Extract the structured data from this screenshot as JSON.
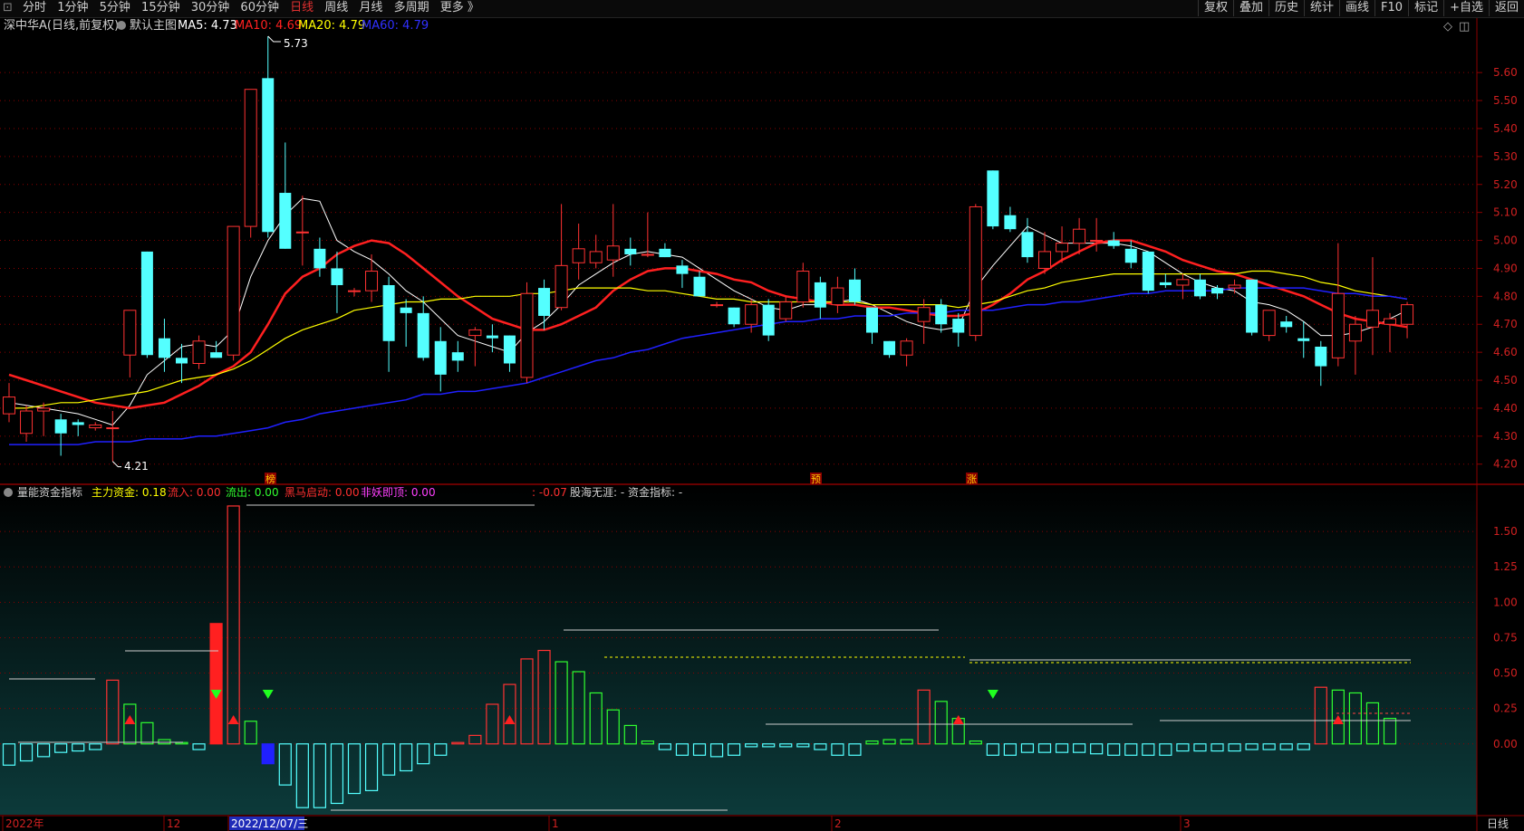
{
  "toolbar": {
    "left_items": [
      {
        "label": "分时",
        "active": false
      },
      {
        "label": "1分钟",
        "active": false
      },
      {
        "label": "5分钟",
        "active": false
      },
      {
        "label": "15分钟",
        "active": false
      },
      {
        "label": "30分钟",
        "active": false
      },
      {
        "label": "60分钟",
        "active": false
      },
      {
        "label": "日线",
        "active": true
      },
      {
        "label": "周线",
        "active": false
      },
      {
        "label": "月线",
        "active": false
      },
      {
        "label": "多周期",
        "active": false
      },
      {
        "label": "更多 》",
        "active": false
      }
    ],
    "right_items": [
      "复权",
      "叠加",
      "历史",
      "统计",
      "画线",
      "F10",
      "标记",
      "+自选",
      "返回"
    ]
  },
  "main_header": {
    "stock": "深中华A(日线,前复权)",
    "template": "默认主图",
    "ma5": "MA5: 4.73",
    "ma10": "MA10: 4.69",
    "ma20": "MA20: 4.79",
    "ma60": "MA60: 4.79"
  },
  "sub_header": {
    "name": "量能资金指标",
    "zlzj": "主力资金: 0.18",
    "lr": "流入: 0.00",
    "lc": "流出: 0.00",
    "hmqd": "黑马启动: 0.00",
    "fydd": "非妖即顶: 0.00",
    "v007": ": -0.07",
    "ghwy": "股海无涯: -",
    "zjzb": "资金指标: -"
  },
  "colors": {
    "up": "#ff3232",
    "down": "#54ffff",
    "ma5": "#ffffff",
    "ma10": "#ff2020",
    "ma20": "#ffff00",
    "ma60": "#2020ff",
    "grid": "#8b0000",
    "axis_text": "#d02020"
  },
  "chart_data": [
    {
      "type": "candlestick",
      "title": "深中华A(日线,前复权)",
      "ylim": [
        4.17,
        5.73
      ],
      "y_ticks": [
        "5.60",
        "5.50",
        "5.40",
        "5.30",
        "5.20",
        "5.10",
        "5.00",
        "4.90",
        "4.80",
        "4.70",
        "4.60",
        "4.50",
        "4.40",
        "4.30",
        "4.20"
      ],
      "x_labels": [
        "2022年",
        "12",
        "2022/12/07/三",
        "1",
        "2",
        "3"
      ],
      "annotations": {
        "high_label": "5.73",
        "low_label": "4.21",
        "markers": [
          "榜",
          "预",
          "涨"
        ]
      },
      "candles": [
        {
          "o": 4.38,
          "h": 4.49,
          "l": 4.35,
          "c": 4.44
        },
        {
          "o": 4.31,
          "h": 4.41,
          "l": 4.28,
          "c": 4.39
        },
        {
          "o": 4.39,
          "h": 4.42,
          "l": 4.3,
          "c": 4.4
        },
        {
          "o": 4.36,
          "h": 4.38,
          "l": 4.23,
          "c": 4.31
        },
        {
          "o": 4.35,
          "h": 4.36,
          "l": 4.3,
          "c": 4.34
        },
        {
          "o": 4.33,
          "h": 4.35,
          "l": 4.32,
          "c": 4.34
        },
        {
          "o": 4.33,
          "h": 4.39,
          "l": 4.21,
          "c": 4.33
        },
        {
          "o": 4.59,
          "h": 4.75,
          "l": 4.51,
          "c": 4.75
        },
        {
          "o": 4.96,
          "h": 4.96,
          "l": 4.58,
          "c": 4.59
        },
        {
          "o": 4.65,
          "h": 4.72,
          "l": 4.53,
          "c": 4.58
        },
        {
          "o": 4.58,
          "h": 4.63,
          "l": 4.49,
          "c": 4.56
        },
        {
          "o": 4.56,
          "h": 4.66,
          "l": 4.54,
          "c": 4.64
        },
        {
          "o": 4.6,
          "h": 4.64,
          "l": 4.58,
          "c": 4.58
        },
        {
          "o": 4.59,
          "h": 5.05,
          "l": 4.57,
          "c": 5.05
        },
        {
          "o": 5.05,
          "h": 5.54,
          "l": 5.01,
          "c": 5.54
        },
        {
          "o": 5.58,
          "h": 5.73,
          "l": 5.01,
          "c": 5.03
        },
        {
          "o": 5.17,
          "h": 5.35,
          "l": 4.97,
          "c": 4.97
        },
        {
          "o": 5.03,
          "h": 5.16,
          "l": 4.91,
          "c": 5.03
        },
        {
          "o": 4.97,
          "h": 5.01,
          "l": 4.87,
          "c": 4.9
        },
        {
          "o": 4.9,
          "h": 4.96,
          "l": 4.74,
          "c": 4.84
        },
        {
          "o": 4.82,
          "h": 4.83,
          "l": 4.8,
          "c": 4.82
        },
        {
          "o": 4.82,
          "h": 4.95,
          "l": 4.78,
          "c": 4.89
        },
        {
          "o": 4.84,
          "h": 4.87,
          "l": 4.53,
          "c": 4.64
        },
        {
          "o": 4.76,
          "h": 4.79,
          "l": 4.62,
          "c": 4.74
        },
        {
          "o": 4.74,
          "h": 4.8,
          "l": 4.57,
          "c": 4.58
        },
        {
          "o": 4.64,
          "h": 4.69,
          "l": 4.46,
          "c": 4.52
        },
        {
          "o": 4.6,
          "h": 4.64,
          "l": 4.53,
          "c": 4.57
        },
        {
          "o": 4.66,
          "h": 4.69,
          "l": 4.55,
          "c": 4.68
        },
        {
          "o": 4.66,
          "h": 4.7,
          "l": 4.6,
          "c": 4.65
        },
        {
          "o": 4.66,
          "h": 4.66,
          "l": 4.53,
          "c": 4.56
        },
        {
          "o": 4.51,
          "h": 4.85,
          "l": 4.49,
          "c": 4.81
        },
        {
          "o": 4.83,
          "h": 4.86,
          "l": 4.68,
          "c": 4.73
        },
        {
          "o": 4.76,
          "h": 5.13,
          "l": 4.75,
          "c": 4.91
        },
        {
          "o": 4.92,
          "h": 5.06,
          "l": 4.86,
          "c": 4.97
        },
        {
          "o": 4.92,
          "h": 5.02,
          "l": 4.9,
          "c": 4.96
        },
        {
          "o": 4.93,
          "h": 5.13,
          "l": 4.87,
          "c": 4.98
        },
        {
          "o": 4.97,
          "h": 5.01,
          "l": 4.91,
          "c": 4.95
        },
        {
          "o": 4.95,
          "h": 5.1,
          "l": 4.94,
          "c": 4.95
        },
        {
          "o": 4.97,
          "h": 4.99,
          "l": 4.94,
          "c": 4.94
        },
        {
          "o": 4.91,
          "h": 4.93,
          "l": 4.83,
          "c": 4.88
        },
        {
          "o": 4.87,
          "h": 4.89,
          "l": 4.81,
          "c": 4.8
        },
        {
          "o": 4.77,
          "h": 4.78,
          "l": 4.76,
          "c": 4.77
        },
        {
          "o": 4.76,
          "h": 4.76,
          "l": 4.69,
          "c": 4.7
        },
        {
          "o": 4.7,
          "h": 4.79,
          "l": 4.67,
          "c": 4.77
        },
        {
          "o": 4.77,
          "h": 4.79,
          "l": 4.64,
          "c": 4.66
        },
        {
          "o": 4.72,
          "h": 4.8,
          "l": 4.71,
          "c": 4.78
        },
        {
          "o": 4.78,
          "h": 4.92,
          "l": 4.76,
          "c": 4.89
        },
        {
          "o": 4.85,
          "h": 4.87,
          "l": 4.72,
          "c": 4.76
        },
        {
          "o": 4.77,
          "h": 4.87,
          "l": 4.74,
          "c": 4.83
        },
        {
          "o": 4.86,
          "h": 4.9,
          "l": 4.77,
          "c": 4.78
        },
        {
          "o": 4.76,
          "h": 4.76,
          "l": 4.63,
          "c": 4.67
        },
        {
          "o": 4.64,
          "h": 4.64,
          "l": 4.58,
          "c": 4.59
        },
        {
          "o": 4.59,
          "h": 4.65,
          "l": 4.55,
          "c": 4.64
        },
        {
          "o": 4.71,
          "h": 4.79,
          "l": 4.63,
          "c": 4.76
        },
        {
          "o": 4.77,
          "h": 4.79,
          "l": 4.67,
          "c": 4.7
        },
        {
          "o": 4.72,
          "h": 4.74,
          "l": 4.62,
          "c": 4.67
        },
        {
          "o": 4.66,
          "h": 5.13,
          "l": 4.64,
          "c": 5.12
        },
        {
          "o": 5.25,
          "h": 5.25,
          "l": 5.04,
          "c": 5.05
        },
        {
          "o": 5.09,
          "h": 5.12,
          "l": 5.03,
          "c": 5.04
        },
        {
          "o": 5.03,
          "h": 5.08,
          "l": 4.92,
          "c": 4.94
        },
        {
          "o": 4.9,
          "h": 5.03,
          "l": 4.88,
          "c": 4.96
        },
        {
          "o": 4.96,
          "h": 5.05,
          "l": 4.92,
          "c": 4.99
        },
        {
          "o": 4.99,
          "h": 5.08,
          "l": 4.95,
          "c": 5.04
        },
        {
          "o": 5.0,
          "h": 5.08,
          "l": 4.96,
          "c": 5.0
        },
        {
          "o": 5.0,
          "h": 5.03,
          "l": 4.97,
          "c": 4.98
        },
        {
          "o": 4.97,
          "h": 5.0,
          "l": 4.9,
          "c": 4.92
        },
        {
          "o": 4.96,
          "h": 4.96,
          "l": 4.81,
          "c": 4.82
        },
        {
          "o": 4.85,
          "h": 4.88,
          "l": 4.83,
          "c": 4.84
        },
        {
          "o": 4.84,
          "h": 4.88,
          "l": 4.79,
          "c": 4.86
        },
        {
          "o": 4.86,
          "h": 4.88,
          "l": 4.79,
          "c": 4.8
        },
        {
          "o": 4.83,
          "h": 4.84,
          "l": 4.79,
          "c": 4.81
        },
        {
          "o": 4.83,
          "h": 4.86,
          "l": 4.81,
          "c": 4.84
        },
        {
          "o": 4.86,
          "h": 4.86,
          "l": 4.66,
          "c": 4.67
        },
        {
          "o": 4.66,
          "h": 4.75,
          "l": 4.64,
          "c": 4.75
        },
        {
          "o": 4.71,
          "h": 4.73,
          "l": 4.67,
          "c": 4.69
        },
        {
          "o": 4.65,
          "h": 4.71,
          "l": 4.58,
          "c": 4.64
        },
        {
          "o": 4.62,
          "h": 4.64,
          "l": 4.48,
          "c": 4.55
        },
        {
          "o": 4.58,
          "h": 4.99,
          "l": 4.55,
          "c": 4.81
        },
        {
          "o": 4.64,
          "h": 4.73,
          "l": 4.52,
          "c": 4.7
        },
        {
          "o": 4.69,
          "h": 4.94,
          "l": 4.59,
          "c": 4.75
        },
        {
          "o": 4.7,
          "h": 4.74,
          "l": 4.6,
          "c": 4.72
        },
        {
          "o": 4.7,
          "h": 4.78,
          "l": 4.65,
          "c": 4.77
        }
      ],
      "ma": {
        "MA5": [
          4.42,
          4.41,
          4.4,
          4.39,
          4.38,
          4.36,
          4.34,
          4.41,
          4.52,
          4.57,
          4.62,
          4.63,
          4.62,
          4.68,
          4.87,
          5.0,
          5.09,
          5.15,
          5.14,
          5.0,
          4.96,
          4.93,
          4.88,
          4.82,
          4.78,
          4.72,
          4.66,
          4.64,
          4.62,
          4.6,
          4.67,
          4.71,
          4.77,
          4.84,
          4.88,
          4.92,
          4.95,
          4.96,
          4.95,
          4.94,
          4.9,
          4.86,
          4.82,
          4.79,
          4.76,
          4.75,
          4.77,
          4.77,
          4.78,
          4.79,
          4.77,
          4.74,
          4.71,
          4.69,
          4.68,
          4.69,
          4.83,
          4.91,
          4.98,
          5.05,
          5.02,
          4.99,
          4.99,
          4.99,
          4.99,
          4.98,
          4.96,
          4.92,
          4.88,
          4.85,
          4.83,
          4.82,
          4.78,
          4.77,
          4.75,
          4.71,
          4.66,
          4.66,
          4.67,
          4.69,
          4.72,
          4.75
        ],
        "MA10": [
          4.52,
          4.5,
          4.48,
          4.46,
          4.44,
          4.42,
          4.41,
          4.4,
          4.41,
          4.42,
          4.45,
          4.48,
          4.52,
          4.55,
          4.6,
          4.7,
          4.81,
          4.87,
          4.9,
          4.95,
          4.98,
          5.0,
          4.99,
          4.95,
          4.9,
          4.85,
          4.8,
          4.76,
          4.72,
          4.7,
          4.68,
          4.68,
          4.7,
          4.73,
          4.76,
          4.82,
          4.86,
          4.89,
          4.9,
          4.9,
          4.89,
          4.88,
          4.86,
          4.85,
          4.82,
          4.8,
          4.79,
          4.78,
          4.77,
          4.77,
          4.76,
          4.76,
          4.75,
          4.74,
          4.73,
          4.73,
          4.74,
          4.77,
          4.81,
          4.86,
          4.89,
          4.93,
          4.96,
          4.99,
          5.0,
          5.0,
          4.98,
          4.96,
          4.93,
          4.91,
          4.89,
          4.88,
          4.86,
          4.84,
          4.82,
          4.8,
          4.77,
          4.74,
          4.72,
          4.71,
          4.7,
          4.69
        ],
        "MA20": [
          4.4,
          4.4,
          4.41,
          4.42,
          4.42,
          4.43,
          4.44,
          4.45,
          4.46,
          4.48,
          4.5,
          4.51,
          4.52,
          4.54,
          4.57,
          4.61,
          4.65,
          4.68,
          4.7,
          4.72,
          4.75,
          4.76,
          4.77,
          4.78,
          4.78,
          4.79,
          4.79,
          4.8,
          4.8,
          4.8,
          4.81,
          4.81,
          4.82,
          4.83,
          4.83,
          4.83,
          4.83,
          4.82,
          4.82,
          4.81,
          4.8,
          4.79,
          4.79,
          4.78,
          4.78,
          4.78,
          4.78,
          4.78,
          4.78,
          4.78,
          4.77,
          4.77,
          4.77,
          4.77,
          4.77,
          4.76,
          4.77,
          4.78,
          4.8,
          4.82,
          4.83,
          4.85,
          4.86,
          4.87,
          4.88,
          4.88,
          4.88,
          4.88,
          4.88,
          4.88,
          4.88,
          4.88,
          4.89,
          4.89,
          4.88,
          4.87,
          4.85,
          4.84,
          4.82,
          4.81,
          4.8,
          4.79
        ],
        "MA60": [
          4.27,
          4.27,
          4.27,
          4.27,
          4.27,
          4.28,
          4.28,
          4.28,
          4.29,
          4.29,
          4.29,
          4.3,
          4.3,
          4.31,
          4.32,
          4.33,
          4.35,
          4.36,
          4.38,
          4.39,
          4.4,
          4.41,
          4.42,
          4.43,
          4.45,
          4.45,
          4.46,
          4.46,
          4.47,
          4.48,
          4.49,
          4.51,
          4.53,
          4.55,
          4.57,
          4.58,
          4.6,
          4.61,
          4.63,
          4.65,
          4.66,
          4.67,
          4.68,
          4.69,
          4.7,
          4.71,
          4.71,
          4.72,
          4.72,
          4.73,
          4.73,
          4.73,
          4.74,
          4.74,
          4.74,
          4.75,
          4.75,
          4.75,
          4.76,
          4.77,
          4.77,
          4.78,
          4.78,
          4.79,
          4.8,
          4.81,
          4.81,
          4.82,
          4.82,
          4.82,
          4.82,
          4.83,
          4.83,
          4.83,
          4.83,
          4.83,
          4.82,
          4.81,
          4.81,
          4.8,
          4.8,
          4.79
        ]
      }
    },
    {
      "type": "bar",
      "title": "量能资金指标",
      "ylim": [
        -0.5,
        1.75
      ],
      "y_ticks": [
        "1.50",
        "1.25",
        "1.00",
        "0.75",
        "0.50",
        "0.25",
        "0.00"
      ],
      "values": [
        -0.15,
        -0.12,
        -0.09,
        -0.06,
        -0.05,
        -0.04,
        0.45,
        0.28,
        0.15,
        0.03,
        0.01,
        -0.04,
        0.85,
        1.68,
        0.16,
        -0.14,
        -0.29,
        -0.45,
        -0.45,
        -0.42,
        -0.35,
        -0.33,
        -0.22,
        -0.19,
        -0.14,
        -0.08,
        0.01,
        0.06,
        0.28,
        0.42,
        0.6,
        0.66,
        0.58,
        0.51,
        0.36,
        0.24,
        0.13,
        0.02,
        -0.04,
        -0.08,
        -0.08,
        -0.09,
        -0.08,
        -0.02,
        -0.02,
        -0.02,
        -0.02,
        -0.04,
        -0.08,
        -0.08,
        0.02,
        0.03,
        0.03,
        0.38,
        0.3,
        0.18,
        0.02,
        -0.08,
        -0.08,
        -0.06,
        -0.06,
        -0.06,
        -0.06,
        -0.07,
        -0.08,
        -0.08,
        -0.08,
        -0.08,
        -0.05,
        -0.05,
        -0.05,
        -0.05,
        -0.04,
        -0.04,
        -0.04,
        -0.04,
        0.4,
        0.38,
        0.36,
        0.29,
        0.18
      ],
      "markers": {
        "up": [
          7,
          13,
          29,
          55,
          77
        ],
        "down": [
          12,
          15,
          57
        ]
      }
    }
  ]
}
